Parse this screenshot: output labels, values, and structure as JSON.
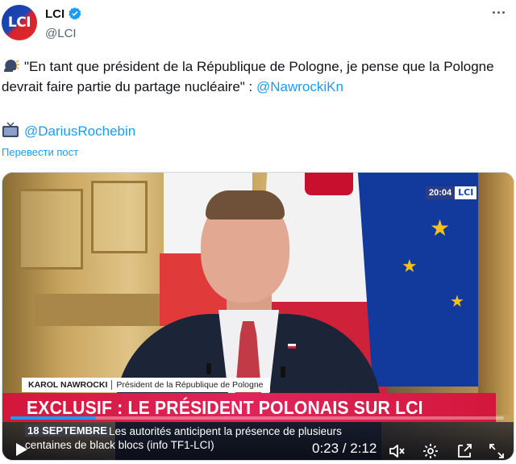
{
  "author": {
    "avatar_text": "LCI",
    "display_name": "LCI",
    "handle": "@LCI"
  },
  "tweet": {
    "quote": "\"En tant que président de la République de Pologne, je pense que la Pologne devrait faire partie du partage nucléaire\" : ",
    "mention1": "@NawrockiKn",
    "mention2": "@DariusRochebin",
    "emoji1": "speaking-head-icon",
    "emoji2": "tv-icon",
    "translate": "Перевести пост"
  },
  "video": {
    "bug_time": "20:04",
    "bug_logo": "LCI",
    "nameplate_name": "KAROL NAWROCKI",
    "nameplate_role": "Président de la République de Pologne",
    "headline": "EXCLUSIF : LE PRÉSIDENT POLONAIS SUR LCI",
    "ticker_date": "18 SEPTEMBRE",
    "ticker_line1": "Les autorités anticipent la présence de plusieurs",
    "ticker_line2": "centaines de black blocs (info TF1-LCI)",
    "time": "0:23 / 2:12",
    "progress": 0.174
  },
  "colors": {
    "accent": "#1d9bf0",
    "headline_red": "#d3173b",
    "brand_blue": "#1b46b8"
  }
}
